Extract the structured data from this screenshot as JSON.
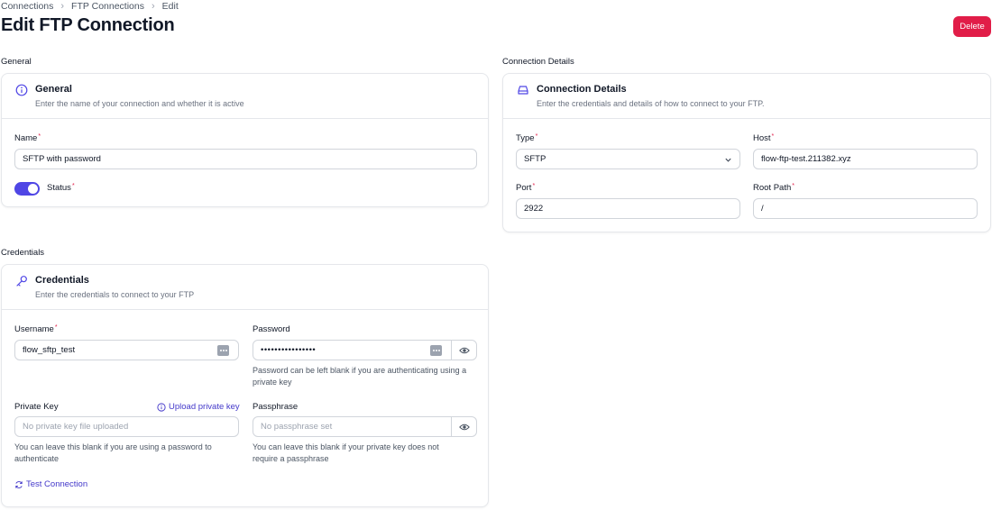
{
  "breadcrumb": {
    "items": [
      "Connections",
      "FTP Connections",
      "Edit"
    ]
  },
  "page": {
    "title": "Edit FTP Connection",
    "delete_label": "Delete"
  },
  "general": {
    "section_label": "General",
    "title": "General",
    "subtitle": "Enter the name of your connection and whether it is active",
    "name_label": "Name",
    "name_value": "SFTP with password",
    "status_label": "Status",
    "status_on": true
  },
  "connection": {
    "section_label": "Connection Details",
    "title": "Connection Details",
    "subtitle": "Enter the credentials and details of how to connect to your FTP.",
    "type_label": "Type",
    "type_value": "SFTP",
    "host_label": "Host",
    "host_value": "flow-ftp-test.211382.xyz",
    "port_label": "Port",
    "port_value": "2922",
    "rootpath_label": "Root Path",
    "rootpath_value": "/"
  },
  "credentials": {
    "section_label": "Credentials",
    "title": "Credentials",
    "subtitle": "Enter the credentials to connect to your FTP",
    "username_label": "Username",
    "username_value": "flow_sftp_test",
    "password_label": "Password",
    "password_value": "••••••••••••••••",
    "password_help_1": "Password can be left blank if you are authenticating using a",
    "password_help_2": "private key",
    "privatekey_label": "Private Key",
    "upload_label": "Upload private key",
    "privatekey_placeholder": "No private key file uploaded",
    "privatekey_help_1": "You can leave this blank if you are using a password to",
    "privatekey_help_2": "authenticate",
    "passphrase_label": "Passphrase",
    "passphrase_placeholder": "No passphrase set",
    "passphrase_help_1": "You can leave this blank if your private key does not",
    "passphrase_help_2": "require a passphrase",
    "test_label": "Test Connection"
  },
  "colors": {
    "accent": "#4f46e5",
    "danger": "#e11d48",
    "required": "#e11d48",
    "link": "#4338ca"
  },
  "icons": [
    "info-icon",
    "drive-icon",
    "key-icon",
    "chevron-down-icon",
    "more-dots-icon",
    "eye-icon",
    "refresh-icon",
    "chevron-right-icon"
  ]
}
